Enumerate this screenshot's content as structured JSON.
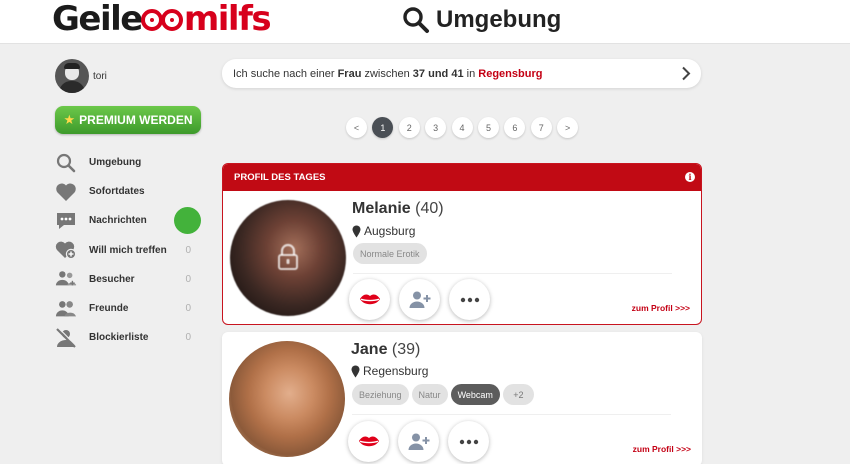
{
  "header": {
    "logo_part1": "Geile",
    "logo_part2": "milfs",
    "title": "Umgebung"
  },
  "user": {
    "name": "tori"
  },
  "premium_label": "PREMIUM WERDEN",
  "nav": [
    {
      "label": "Umgebung",
      "icon": "search-icon",
      "count": ""
    },
    {
      "label": "Sofortdates",
      "icon": "heart-icon",
      "count": ""
    },
    {
      "label": "Nachrichten",
      "icon": "chat-icon",
      "count": ""
    },
    {
      "label": "Will mich treffen",
      "icon": "heart-plus-icon",
      "count": "0"
    },
    {
      "label": "Besucher",
      "icon": "visitors-icon",
      "count": "0"
    },
    {
      "label": "Freunde",
      "icon": "friends-icon",
      "count": "0"
    },
    {
      "label": "Blockierliste",
      "icon": "blocked-user-icon",
      "count": "0"
    }
  ],
  "search": {
    "prefix": "Ich suche nach einer",
    "gender": "Frau",
    "between": "zwischen",
    "age_from": "37",
    "and": "und",
    "age_to": "41",
    "in": "in",
    "city": "Regensburg"
  },
  "pagination": {
    "prev": "<",
    "pages": [
      "1",
      "2",
      "3",
      "4",
      "5",
      "6",
      "7"
    ],
    "active": "1",
    "next": ">"
  },
  "profile_of_day_label": "PROFIL DES TAGES",
  "profiles": [
    {
      "name": "Melanie",
      "age": "(40)",
      "city": "Augsburg",
      "tags": [
        "Normale Erotik"
      ],
      "link": "zum Profil >>>"
    },
    {
      "name": "Jane",
      "age": "(39)",
      "city": "Regensburg",
      "tags": [
        "Beziehung",
        "Natur",
        "Webcam"
      ],
      "more": "+2",
      "link": "zum Profil >>>"
    }
  ],
  "colors": {
    "brand_red": "#c10a14",
    "premium_green": "#4caf36",
    "online_green": "#43b23b"
  }
}
